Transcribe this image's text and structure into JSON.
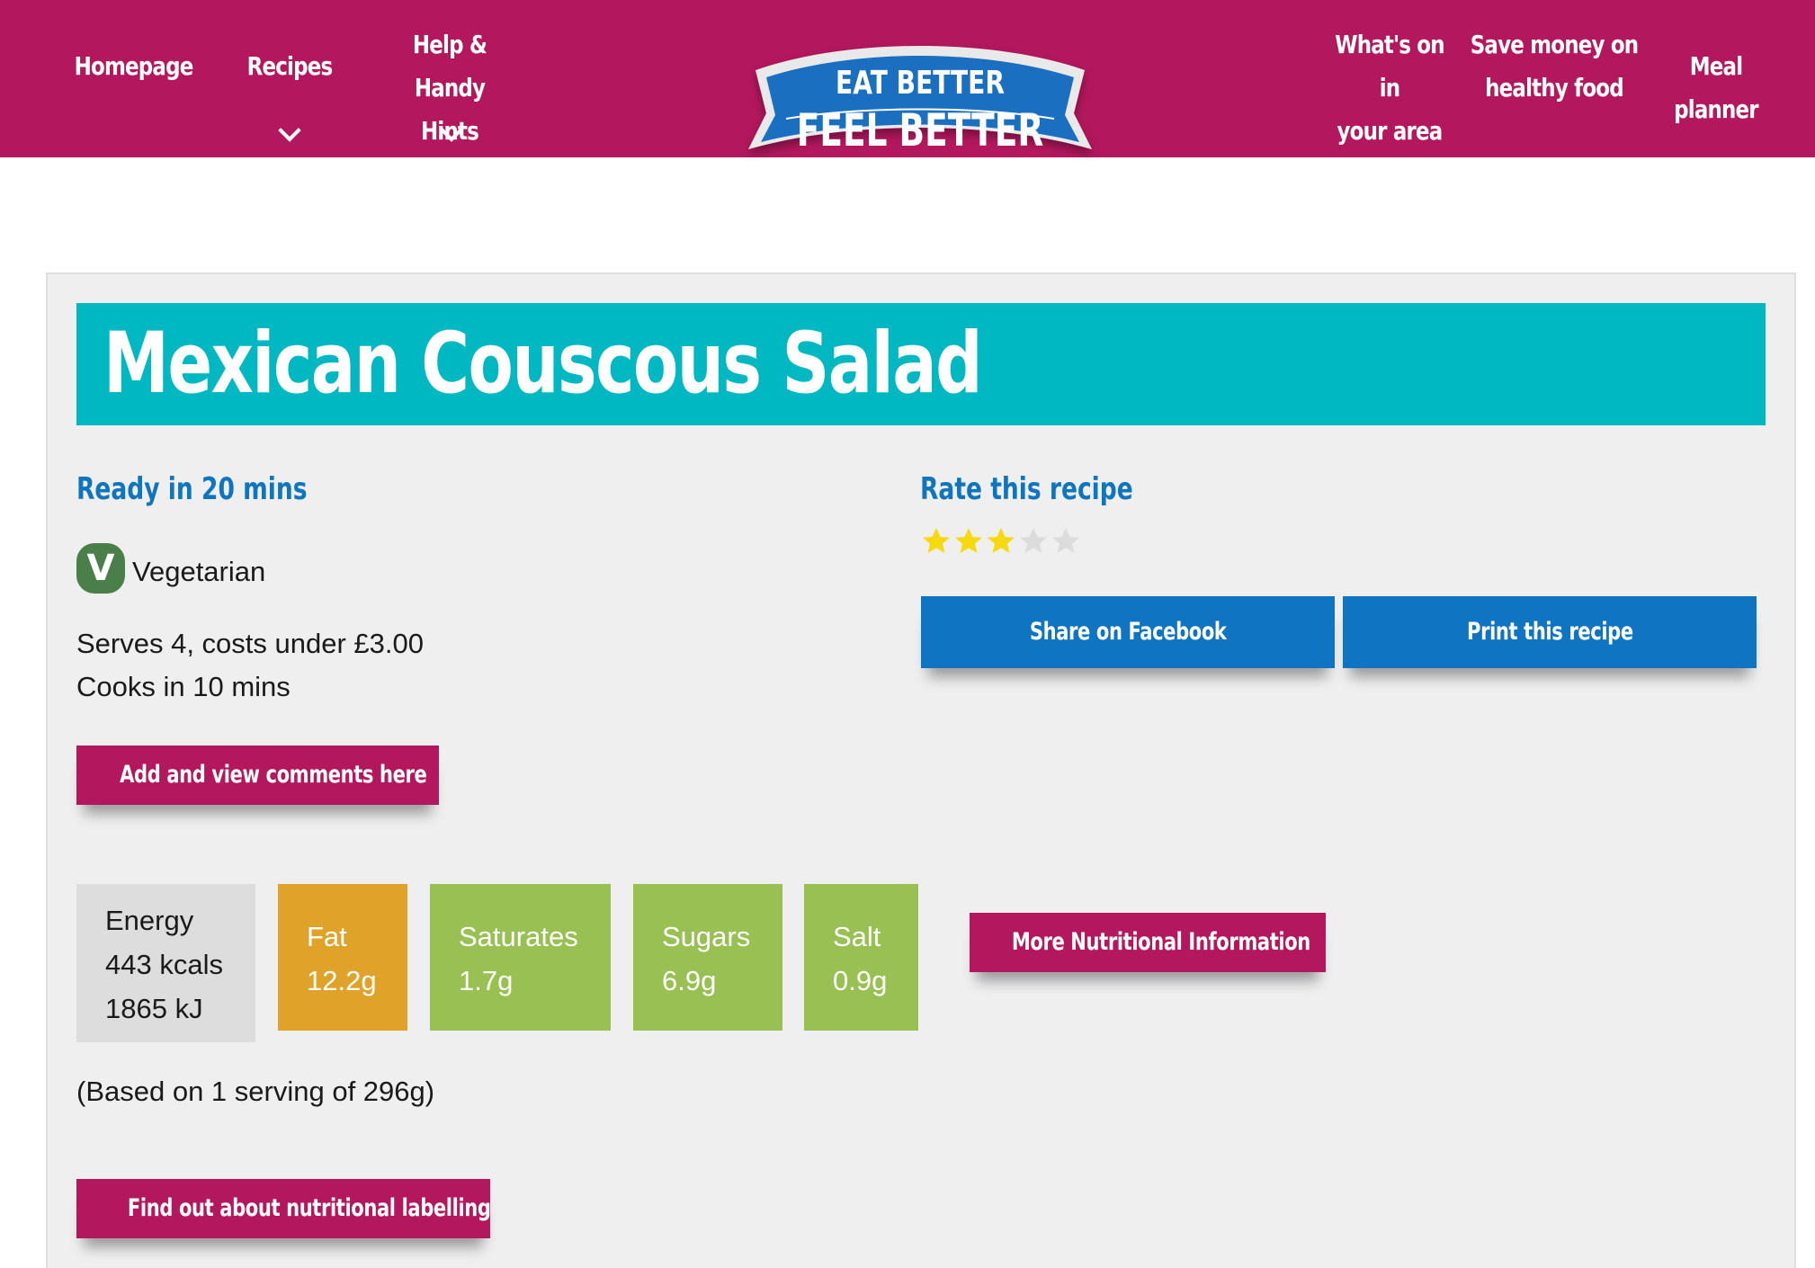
{
  "header": {
    "nav_left": [
      {
        "label_line1": "Homepage",
        "label_line2": ""
      },
      {
        "label_line1": "Recipes",
        "label_line2": ""
      },
      {
        "label_line1": "Help & Handy",
        "label_line2": "Hints"
      }
    ],
    "nav_right": [
      {
        "label_line1": "What's on in",
        "label_line2": "your area"
      },
      {
        "label_line1": "Save money on",
        "label_line2": "healthy food"
      },
      {
        "label_line1": "Meal planner",
        "label_line2": ""
      }
    ],
    "logo": {
      "line1": "EAT BETTER",
      "line2": "FEEL BETTER"
    },
    "colors": {
      "bar": "#b3175d",
      "logo_blue": "#1a6fc0"
    }
  },
  "recipe": {
    "title": "Mexican Couscous Salad",
    "ready_in": "Ready in 20 mins",
    "veg_badge": "V",
    "veg_label": "Vegetarian",
    "serves": "Serves 4, costs under £3.00",
    "cooks": "Cooks in 10 mins",
    "comments_button": "Add and view comments here"
  },
  "rating": {
    "heading": "Rate this recipe",
    "value": 3,
    "max": 5,
    "share_button": "Share on Facebook",
    "print_button": "Print this recipe"
  },
  "nutrition": {
    "energy": {
      "label": "Energy",
      "kcal": "443 kcals",
      "kj": "1865 kJ"
    },
    "fat": {
      "label": "Fat",
      "value": "12.2g",
      "level": "amber"
    },
    "saturates": {
      "label": "Saturates",
      "value": "1.7g",
      "level": "green"
    },
    "sugars": {
      "label": "Sugars",
      "value": "6.9g",
      "level": "green"
    },
    "salt": {
      "label": "Salt",
      "value": "0.9g",
      "level": "green"
    },
    "more_button": "More Nutritional Information",
    "serving_note": "(Based on 1 serving of 296g)",
    "labelling_button": "Find out about nutritional labelling"
  },
  "icons": {
    "dropdown": "chevron-down-icon",
    "star": "star-icon",
    "vegetarian": "vegetarian-icon"
  }
}
